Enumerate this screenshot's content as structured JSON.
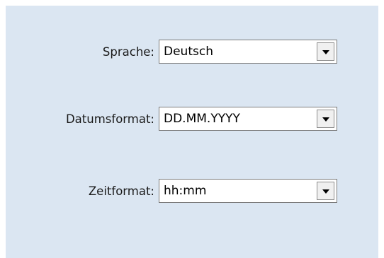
{
  "settings": {
    "language": {
      "label": "Sprache:",
      "value": "Deutsch"
    },
    "date_format": {
      "label": "Datumsformat:",
      "value": "DD.MM.YYYY"
    },
    "time_format": {
      "label": "Zeitformat:",
      "value": "hh:mm"
    }
  }
}
